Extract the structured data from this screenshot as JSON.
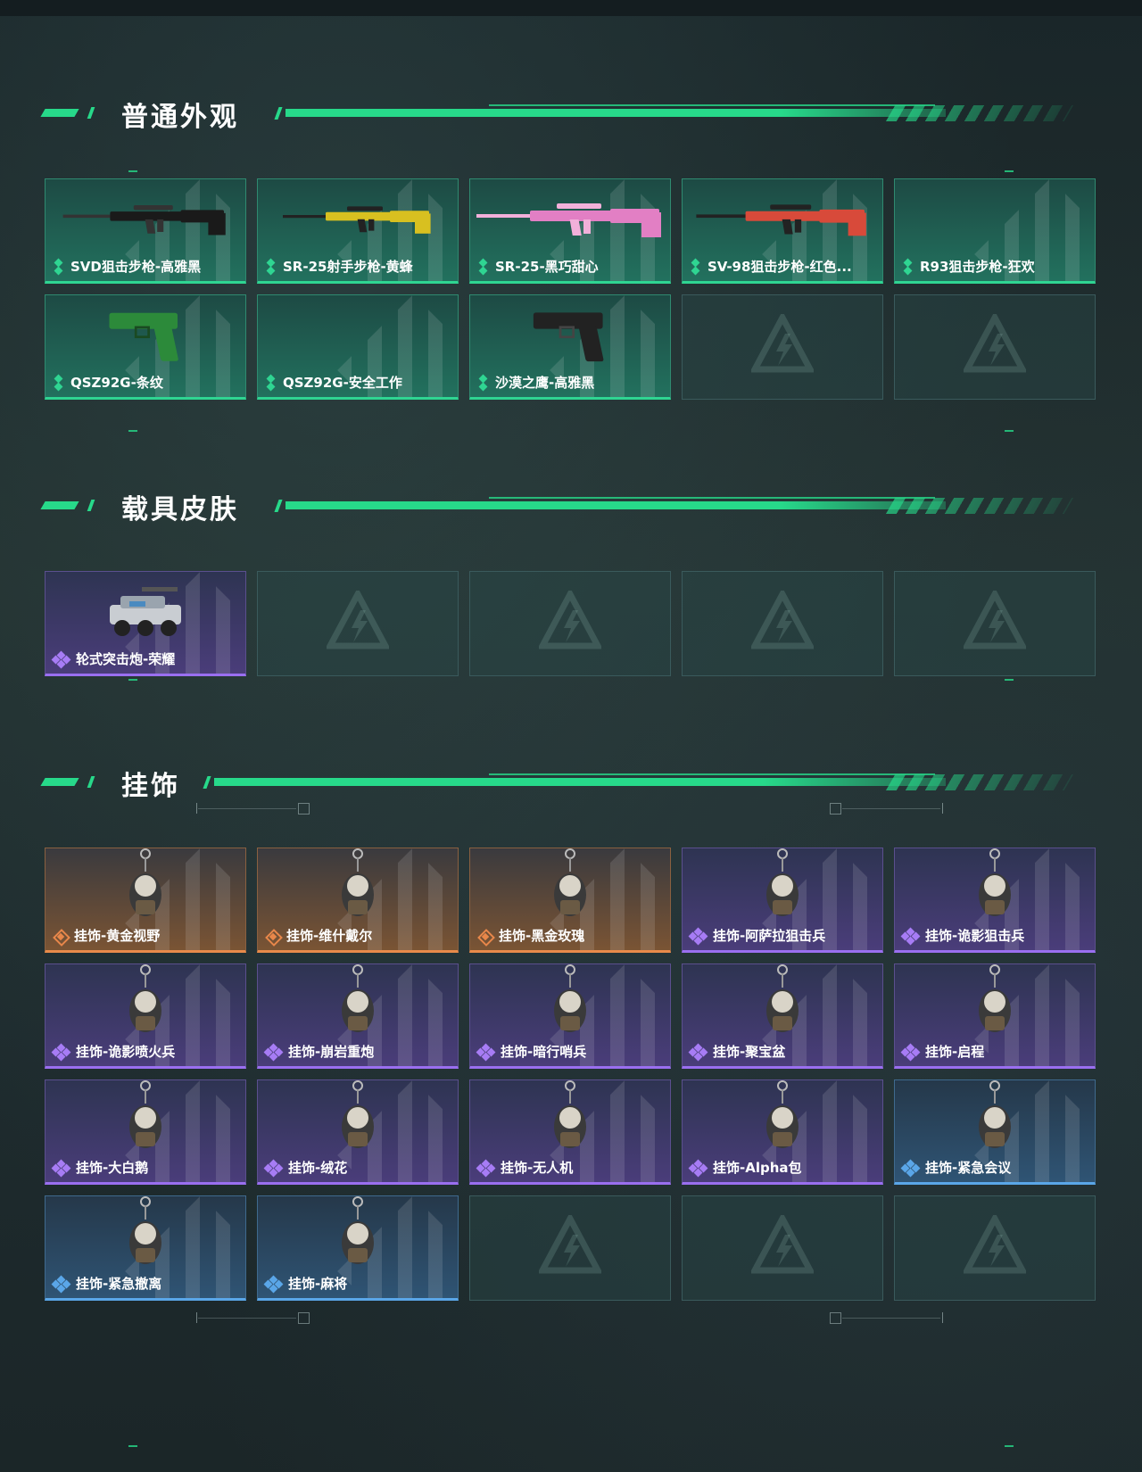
{
  "colors": {
    "accent": "#27d98a",
    "green": "#2fd592",
    "purple": "#9a6ff0",
    "orange": "#e88a4a",
    "blue": "#5aa6e8"
  },
  "sections": {
    "weapons": {
      "title": "普通外观"
    },
    "vehicles": {
      "title": "载具皮肤"
    },
    "charms": {
      "title": "挂饰"
    }
  },
  "weapons": [
    {
      "label": "SVD狙击步枪-高雅黑",
      "rarity": "green",
      "icon": "rifle-black-icon"
    },
    {
      "label": "SR-25射手步枪-黄蜂",
      "rarity": "green",
      "icon": "rifle-yellow-icon"
    },
    {
      "label": "SR-25-黑巧甜心",
      "rarity": "green",
      "icon": "rifle-pink-icon"
    },
    {
      "label": "SV-98狙击步枪-红色...",
      "rarity": "green",
      "icon": "rifle-red-icon"
    },
    {
      "label": "R93狙击步枪-狂欢",
      "rarity": "green",
      "icon": ""
    },
    {
      "label": "QSZ92G-条纹",
      "rarity": "green",
      "icon": "pistol-green-icon"
    },
    {
      "label": "QSZ92G-安全工作",
      "rarity": "green",
      "icon": ""
    },
    {
      "label": "沙漠之鹰-高雅黑",
      "rarity": "green",
      "icon": "pistol-black-icon"
    }
  ],
  "vehicles": [
    {
      "label": "轮式突击炮-荣耀",
      "rarity": "purple",
      "icon": "armored-vehicle-icon"
    }
  ],
  "charms": [
    {
      "label": "挂饰-黄金视野",
      "rarity": "orange",
      "icon": "charm-duck-icon"
    },
    {
      "label": "挂饰-维什戴尔",
      "rarity": "orange",
      "icon": "charm-device-icon"
    },
    {
      "label": "挂饰-黑金玫瑰",
      "rarity": "orange",
      "icon": "charm-teapot-icon"
    },
    {
      "label": "挂饰-阿萨拉狙击兵",
      "rarity": "purple",
      "icon": "charm-sniper-icon"
    },
    {
      "label": "挂饰-诡影狙击兵",
      "rarity": "purple",
      "icon": "charm-shadow-sniper-icon"
    },
    {
      "label": "挂饰-诡影喷火兵",
      "rarity": "purple",
      "icon": "charm-flamer-icon"
    },
    {
      "label": "挂饰-崩岩重炮",
      "rarity": "purple",
      "icon": "charm-heavy-icon"
    },
    {
      "label": "挂饰-暗行哨兵",
      "rarity": "purple",
      "icon": "charm-sentry-icon"
    },
    {
      "label": "挂饰-聚宝盆",
      "rarity": "purple",
      "icon": "charm-treasure-bowl-icon"
    },
    {
      "label": "挂饰-启程",
      "rarity": "purple",
      "icon": "charm-compass-icon"
    },
    {
      "label": "挂饰-大白鹅",
      "rarity": "purple",
      "icon": "charm-goose-icon"
    },
    {
      "label": "挂饰-绒花",
      "rarity": "purple",
      "icon": "charm-flower-icon"
    },
    {
      "label": "挂饰-无人机",
      "rarity": "purple",
      "icon": "charm-drone-icon"
    },
    {
      "label": "挂饰-Alpha包",
      "rarity": "purple",
      "icon": "charm-bag-icon"
    },
    {
      "label": "挂饰-紧急会议",
      "rarity": "blue",
      "icon": "charm-meeting-icon"
    },
    {
      "label": "挂饰-紧急撤离",
      "rarity": "blue",
      "icon": "charm-evac-icon"
    },
    {
      "label": "挂饰-麻将",
      "rarity": "blue",
      "icon": "charm-mahjong-icon"
    }
  ]
}
